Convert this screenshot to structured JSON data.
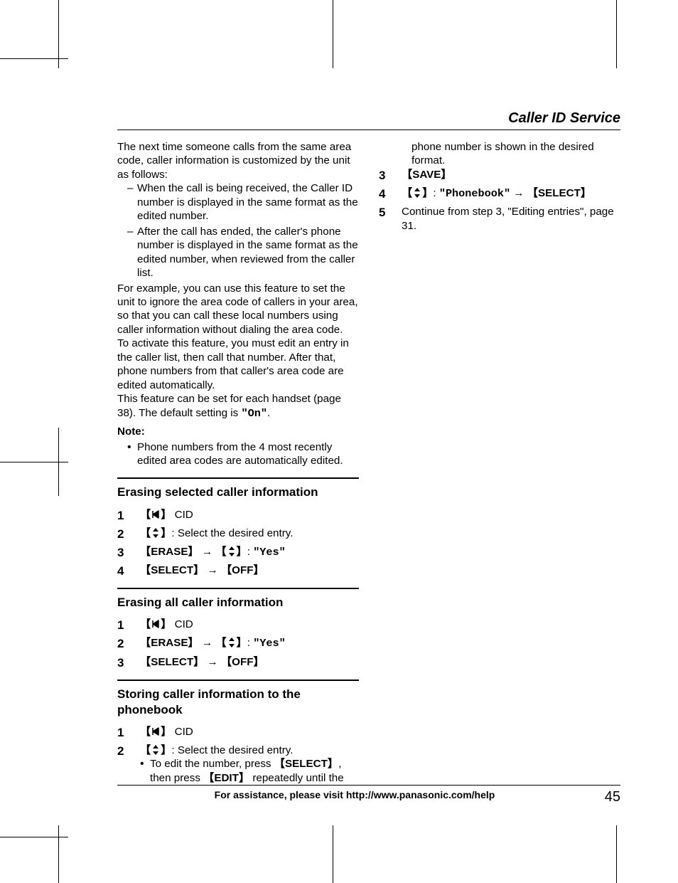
{
  "header": {
    "title": "Caller ID Service"
  },
  "left": {
    "intro": "The next time someone calls from the same area code, caller information is customized by the unit as follows:",
    "dash1": "When the call is being received, the Caller ID number is displayed in the same format as the edited number.",
    "dash2": "After the call has ended, the caller's phone number is displayed in the same format as the edited number, when reviewed from the caller list.",
    "para2": "For example, you can use this feature to set the unit to ignore the area code of callers in your area, so that you can call these local numbers using caller information without dialing the area code.",
    "para3": "To activate this feature, you must edit an entry in the caller list, then call that number. After that, phone numbers from that caller's area code are edited automatically.",
    "para4_pre": "This feature can be set for each handset (page 38). The default setting is ",
    "para4_mono": "\"On\"",
    "para4_post": ".",
    "note_label": "Note:",
    "note_bullet": "Phone numbers from the 4 most recently edited area codes are automatically edited.",
    "sec1_title": "Erasing selected caller information",
    "sec1": {
      "s1_cid": " CID",
      "s2_txt": ": Select the desired entry.",
      "s3_erase": "ERASE",
      "s3_yes": "\"Yes\"",
      "s4_select": "SELECT",
      "s4_off": "OFF"
    },
    "sec2_title": "Erasing all caller information",
    "sec2": {
      "s1_cid": " CID",
      "s2_erase": "ERASE",
      "s2_yes": "\"Yes\"",
      "s3_select": "SELECT",
      "s3_off": "OFF"
    },
    "sec3_title": "Storing caller information to the phonebook",
    "sec3": {
      "s1_cid": " CID",
      "s2_txt": ": Select the desired entry.",
      "s2_sub_pre": "To edit the number, press ",
      "s2_sub_select": "SELECT",
      "s2_sub_mid": ", then press ",
      "s2_sub_edit": "EDIT",
      "s2_sub_post": " repeatedly until the"
    }
  },
  "right": {
    "cont": "phone number is shown in the desired format.",
    "s3_save": "SAVE",
    "s4_phonebook": "\"Phonebook\"",
    "s4_select": "SELECT",
    "s5": "Continue from step 3, \"Editing entries\", page 31."
  },
  "footer": {
    "text": "For assistance, please visit http://www.panasonic.com/help",
    "page": "45"
  },
  "glyph": {
    "lbr": "【",
    "rbr": "】",
    "arrow": "→"
  }
}
